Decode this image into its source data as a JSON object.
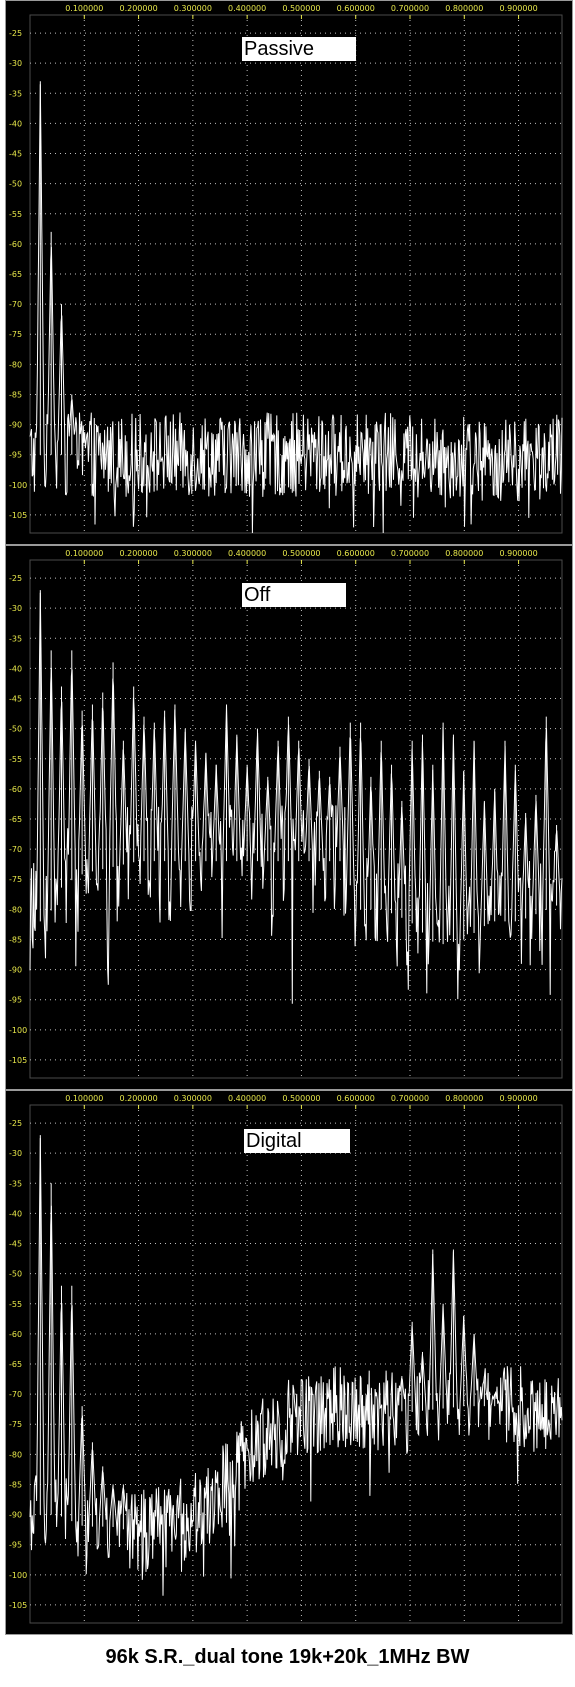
{
  "caption": "96k S.R._dual tone 19k+20k_1MHz BW",
  "colors": {
    "background": "#000000",
    "trace": "#ffffff",
    "grid": "#bfbfbf",
    "x_tick": "#e8e84a",
    "y_tick": "#e8e84a",
    "border": "#9a9a9a"
  },
  "chart_data": [
    {
      "type": "line",
      "title": "Passive",
      "xlim": [
        0.0,
        0.98
      ],
      "ylim": [
        -108,
        -22
      ],
      "x_ticks": [
        "0.100000",
        "0.200000",
        "0.300000",
        "0.400000",
        "0.500000",
        "0.600000",
        "0.700000",
        "0.800000",
        "0.900000"
      ],
      "x_tick_values": [
        0.1,
        0.2,
        0.3,
        0.4,
        0.5,
        0.6,
        0.7,
        0.8,
        0.9
      ],
      "y_ticks": [
        "-25",
        "-30",
        "-35",
        "-40",
        "-45",
        "-50",
        "-55",
        "-60",
        "-65",
        "-70",
        "-75",
        "-80",
        "-85",
        "-90",
        "-95",
        "-100",
        "-105"
      ],
      "y_tick_values": [
        -25,
        -30,
        -35,
        -40,
        -45,
        -50,
        -55,
        -60,
        -65,
        -70,
        -75,
        -80,
        -85,
        -90,
        -95,
        -100,
        -105
      ],
      "grid": true,
      "peaks": [
        [
          0.019,
          -33
        ],
        [
          0.039,
          -58
        ],
        [
          0.058,
          -70
        ],
        [
          0.077,
          -85
        ]
      ],
      "noise_floor": [
        [
          0.0,
          -95
        ],
        [
          0.1,
          -95
        ],
        [
          0.3,
          -95
        ],
        [
          0.5,
          -95
        ],
        [
          0.7,
          -95
        ],
        [
          0.9,
          -96
        ],
        [
          0.98,
          -95
        ]
      ],
      "noise_spread": 7
    },
    {
      "type": "line",
      "title": "Off",
      "xlim": [
        0.0,
        0.98
      ],
      "ylim": [
        -108,
        -22
      ],
      "x_ticks": [
        "0.100000",
        "0.200000",
        "0.300000",
        "0.400000",
        "0.500000",
        "0.600000",
        "0.700000",
        "0.800000",
        "0.900000"
      ],
      "x_tick_values": [
        0.1,
        0.2,
        0.3,
        0.4,
        0.5,
        0.6,
        0.7,
        0.8,
        0.9
      ],
      "y_ticks": [
        "-25",
        "-30",
        "-35",
        "-40",
        "-45",
        "-50",
        "-55",
        "-60",
        "-65",
        "-70",
        "-75",
        "-80",
        "-85",
        "-90",
        "-95",
        "-100",
        "-105"
      ],
      "y_tick_values": [
        -25,
        -30,
        -35,
        -40,
        -45,
        -50,
        -55,
        -60,
        -65,
        -70,
        -75,
        -80,
        -85,
        -90,
        -95,
        -100,
        -105
      ],
      "grid": true,
      "peaks": [
        [
          0.019,
          -27
        ],
        [
          0.039,
          -37
        ],
        [
          0.058,
          -43
        ],
        [
          0.077,
          -37
        ],
        [
          0.096,
          -47
        ],
        [
          0.115,
          -46
        ],
        [
          0.134,
          -44
        ],
        [
          0.153,
          -39
        ],
        [
          0.172,
          -52
        ],
        [
          0.191,
          -43
        ],
        [
          0.21,
          -48
        ],
        [
          0.229,
          -49
        ],
        [
          0.248,
          -47
        ],
        [
          0.267,
          -46
        ],
        [
          0.286,
          -50
        ],
        [
          0.305,
          -52
        ],
        [
          0.324,
          -54
        ],
        [
          0.343,
          -56
        ],
        [
          0.362,
          -46
        ],
        [
          0.381,
          -51
        ],
        [
          0.4,
          -56
        ],
        [
          0.419,
          -50
        ],
        [
          0.438,
          -58
        ],
        [
          0.457,
          -52
        ],
        [
          0.476,
          -48
        ],
        [
          0.495,
          -52
        ],
        [
          0.514,
          -55
        ],
        [
          0.533,
          -57
        ],
        [
          0.552,
          -58
        ],
        [
          0.571,
          -53
        ],
        [
          0.59,
          -49
        ],
        [
          0.609,
          -49
        ],
        [
          0.628,
          -58
        ],
        [
          0.647,
          -52
        ],
        [
          0.666,
          -56
        ],
        [
          0.685,
          -62
        ],
        [
          0.704,
          -52
        ],
        [
          0.723,
          -51
        ],
        [
          0.742,
          -56
        ],
        [
          0.761,
          -49
        ],
        [
          0.78,
          -51
        ],
        [
          0.799,
          -57
        ],
        [
          0.818,
          -52
        ],
        [
          0.837,
          -62
        ],
        [
          0.856,
          -60
        ],
        [
          0.875,
          -52
        ],
        [
          0.894,
          -56
        ],
        [
          0.913,
          -64
        ],
        [
          0.932,
          -61
        ],
        [
          0.951,
          -48
        ],
        [
          0.97,
          -66
        ]
      ],
      "noise_floor": [
        [
          0.0,
          -82
        ],
        [
          0.03,
          -82
        ],
        [
          0.06,
          -76
        ],
        [
          0.1,
          -74
        ],
        [
          0.2,
          -72
        ],
        [
          0.3,
          -72
        ],
        [
          0.45,
          -72
        ],
        [
          0.58,
          -72
        ],
        [
          0.6,
          -80
        ],
        [
          0.65,
          -80
        ],
        [
          0.7,
          -82
        ],
        [
          0.75,
          -86
        ],
        [
          0.8,
          -85
        ],
        [
          0.85,
          -82
        ],
        [
          0.9,
          -82
        ],
        [
          0.98,
          -79
        ]
      ],
      "noise_spread": 10
    },
    {
      "type": "line",
      "title": "Digital",
      "xlim": [
        0.0,
        0.98
      ],
      "ylim": [
        -108,
        -22
      ],
      "x_ticks": [
        "0.100000",
        "0.200000",
        "0.300000",
        "0.400000",
        "0.500000",
        "0.600000",
        "0.700000",
        "0.800000",
        "0.900000"
      ],
      "x_tick_values": [
        0.1,
        0.2,
        0.3,
        0.4,
        0.5,
        0.6,
        0.7,
        0.8,
        0.9
      ],
      "y_ticks": [
        "-25",
        "-30",
        "-35",
        "-40",
        "-45",
        "-50",
        "-55",
        "-60",
        "-65",
        "-70",
        "-75",
        "-80",
        "-85",
        "-90",
        "-95",
        "-100",
        "-105"
      ],
      "y_tick_values": [
        -25,
        -30,
        -35,
        -40,
        -45,
        -50,
        -55,
        -60,
        -65,
        -70,
        -75,
        -80,
        -85,
        -90,
        -95,
        -100,
        -105
      ],
      "grid": true,
      "peaks": [
        [
          0.019,
          -27
        ],
        [
          0.039,
          -35
        ],
        [
          0.058,
          -52
        ],
        [
          0.077,
          -52
        ],
        [
          0.096,
          -72
        ],
        [
          0.115,
          -78
        ],
        [
          0.134,
          -82
        ],
        [
          0.153,
          -85
        ],
        [
          0.172,
          -85
        ],
        [
          0.685,
          -67
        ],
        [
          0.704,
          -58
        ],
        [
          0.723,
          -63
        ],
        [
          0.742,
          -46
        ],
        [
          0.761,
          -55
        ],
        [
          0.78,
          -46
        ],
        [
          0.799,
          -57
        ],
        [
          0.818,
          -60
        ],
        [
          0.837,
          -67
        ],
        [
          0.856,
          -70
        ]
      ],
      "noise_floor": [
        [
          0.0,
          -90
        ],
        [
          0.05,
          -90
        ],
        [
          0.1,
          -92
        ],
        [
          0.15,
          -92
        ],
        [
          0.2,
          -93
        ],
        [
          0.25,
          -92
        ],
        [
          0.3,
          -90
        ],
        [
          0.35,
          -86
        ],
        [
          0.4,
          -80
        ],
        [
          0.45,
          -76
        ],
        [
          0.5,
          -73
        ],
        [
          0.6,
          -72
        ],
        [
          0.7,
          -73
        ],
        [
          0.8,
          -72
        ],
        [
          0.9,
          -72
        ],
        [
          0.98,
          -73
        ]
      ],
      "noise_spread": 7
    }
  ]
}
